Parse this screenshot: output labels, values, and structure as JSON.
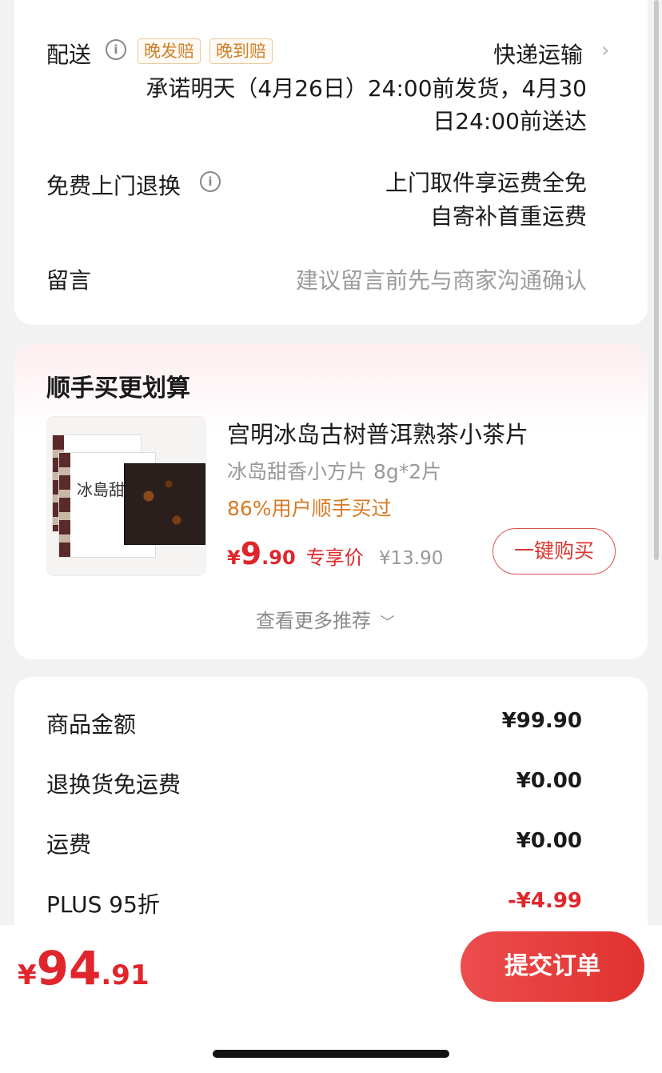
{
  "delivery": {
    "label": "配送",
    "tags": [
      "晚发赔",
      "晚到赔"
    ],
    "method": "快递运输",
    "promise_line1": "承诺明天（4月26日）24:00前发货，4月30",
    "promise_line2": "日24:00前送达"
  },
  "returns": {
    "label": "免费上门退换",
    "line1": "上门取件享运费全免",
    "line2": "自寄补首重运费"
  },
  "message": {
    "label": "留言",
    "placeholder": "建议留言前先与商家沟通确认"
  },
  "upsell": {
    "title": "顺手买更划算",
    "product_name": "宫明冰岛古树普洱熟茶小茶片",
    "product_spec": "冰岛甜香小方片 8g*2片",
    "bought_text": "86%用户顺手买过",
    "price_symbol": "¥",
    "price_int": "9",
    "price_dec": ".90",
    "price_label": "专享价",
    "original_price": "¥13.90",
    "buy_button": "一键购买",
    "more": "查看更多推荐",
    "image_text": "冰島甜"
  },
  "fees": [
    {
      "label": "商品金额",
      "value": "¥99.90",
      "color": "#1a1a1a"
    },
    {
      "label": "退换货免运费",
      "value": "¥0.00",
      "color": "#1a1a1a"
    },
    {
      "label": "运费",
      "value": "¥0.00",
      "color": "#1a1a1a"
    },
    {
      "label": "PLUS 95折",
      "value": "-¥4.99",
      "color": "#e0262c"
    }
  ],
  "footer": {
    "currency": "¥",
    "total_int": "94",
    "total_dec": ".91",
    "submit": "提交订单"
  },
  "icons": {
    "info": "info-icon",
    "chevron_right": "chevron-right-icon",
    "chevron_down": "chevron-down-icon"
  }
}
